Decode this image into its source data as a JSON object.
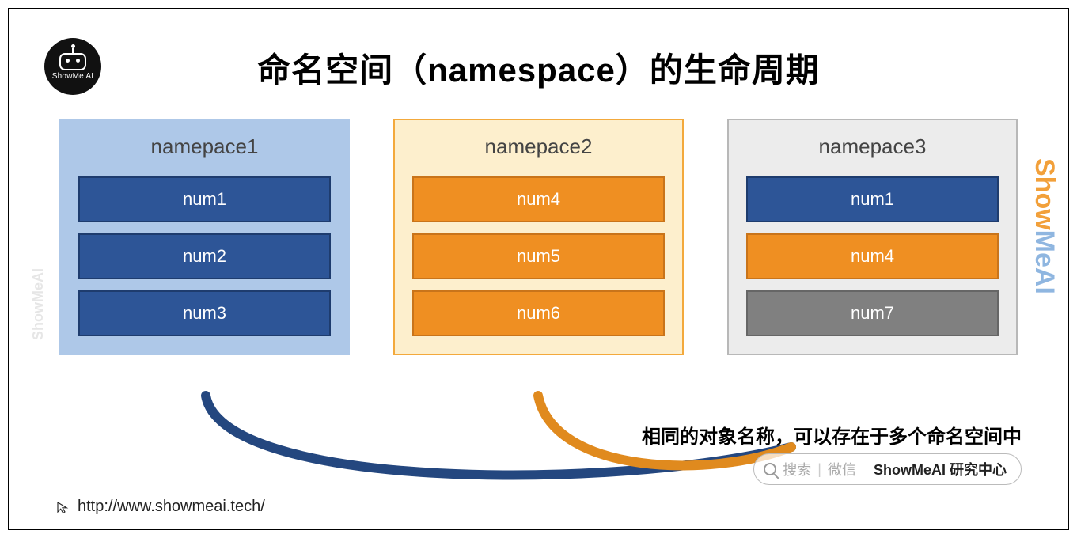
{
  "title": "命名空间（namespace）的生命周期",
  "logo_brand": "ShowMe AI",
  "namespaces": [
    {
      "name": "namepace1",
      "theme": "blue",
      "items": [
        {
          "label": "num1",
          "color": "blue"
        },
        {
          "label": "num2",
          "color": "blue"
        },
        {
          "label": "num3",
          "color": "blue"
        }
      ]
    },
    {
      "name": "namepace2",
      "theme": "yellow",
      "items": [
        {
          "label": "num4",
          "color": "orange"
        },
        {
          "label": "num5",
          "color": "orange"
        },
        {
          "label": "num6",
          "color": "orange"
        }
      ]
    },
    {
      "name": "namepace3",
      "theme": "gray",
      "items": [
        {
          "label": "num1",
          "color": "blue"
        },
        {
          "label": "num4",
          "color": "orange"
        },
        {
          "label": "num7",
          "color": "gray"
        }
      ]
    }
  ],
  "caption": "相同的对象名称，可以存在于多个命名空间中",
  "search": {
    "label_search": "搜索",
    "label_wechat": "微信",
    "label_brand": "ShowMeAI 研究中心"
  },
  "footer_url": "http://www.showmeai.tech/",
  "watermark_left": "ShowMeAI",
  "watermark_right": "ShowMeAI",
  "colors": {
    "blue_fill": "#2d5597",
    "orange_fill": "#ef8f22",
    "gray_fill": "#808080",
    "ns_blue_bg": "#aec8e8",
    "ns_yellow_bg": "#fdefcd",
    "ns_yellow_border": "#f3a93c",
    "ns_gray_bg": "#ececec"
  }
}
